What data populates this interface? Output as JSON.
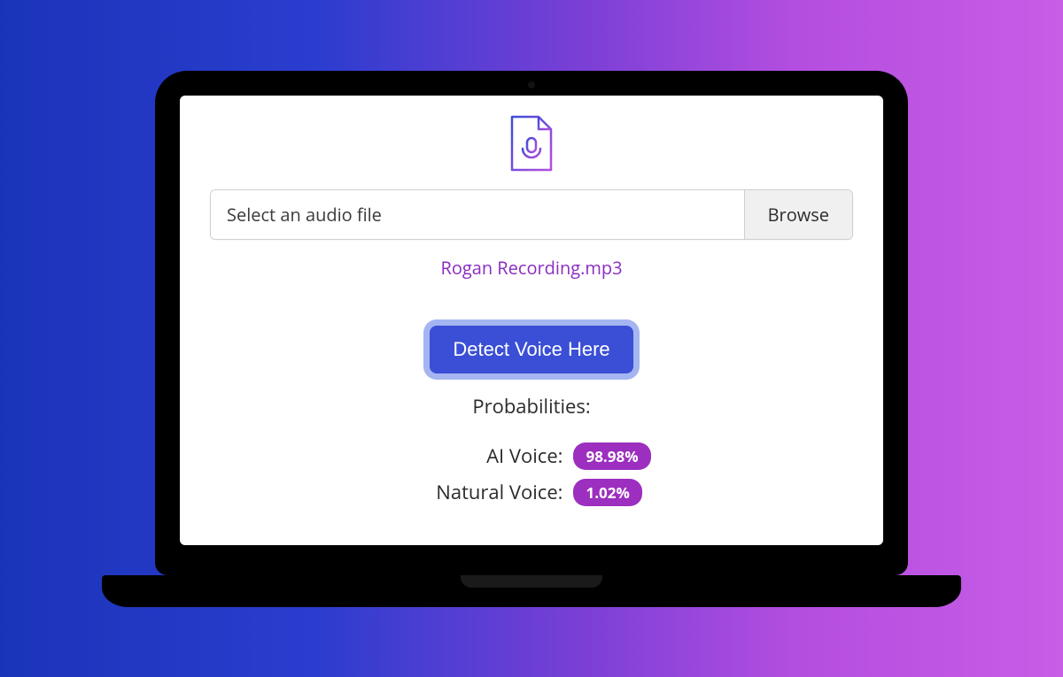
{
  "icon": {
    "name": "audio-file-icon"
  },
  "filePicker": {
    "placeholder": "Select an audio file",
    "browse_label": "Browse",
    "selected_file": "Rogan Recording.mp3"
  },
  "action": {
    "detect_label": "Detect Voice Here"
  },
  "results": {
    "heading": "Probabilities:",
    "ai_label": "AI Voice:",
    "ai_value": "98.98%",
    "natural_label": "Natural Voice:",
    "natural_value": "1.02%"
  },
  "colors": {
    "accent_pill": "#9c2fbf",
    "primary_button": "#3a4ed6",
    "filename_link": "#8a2cc0"
  }
}
